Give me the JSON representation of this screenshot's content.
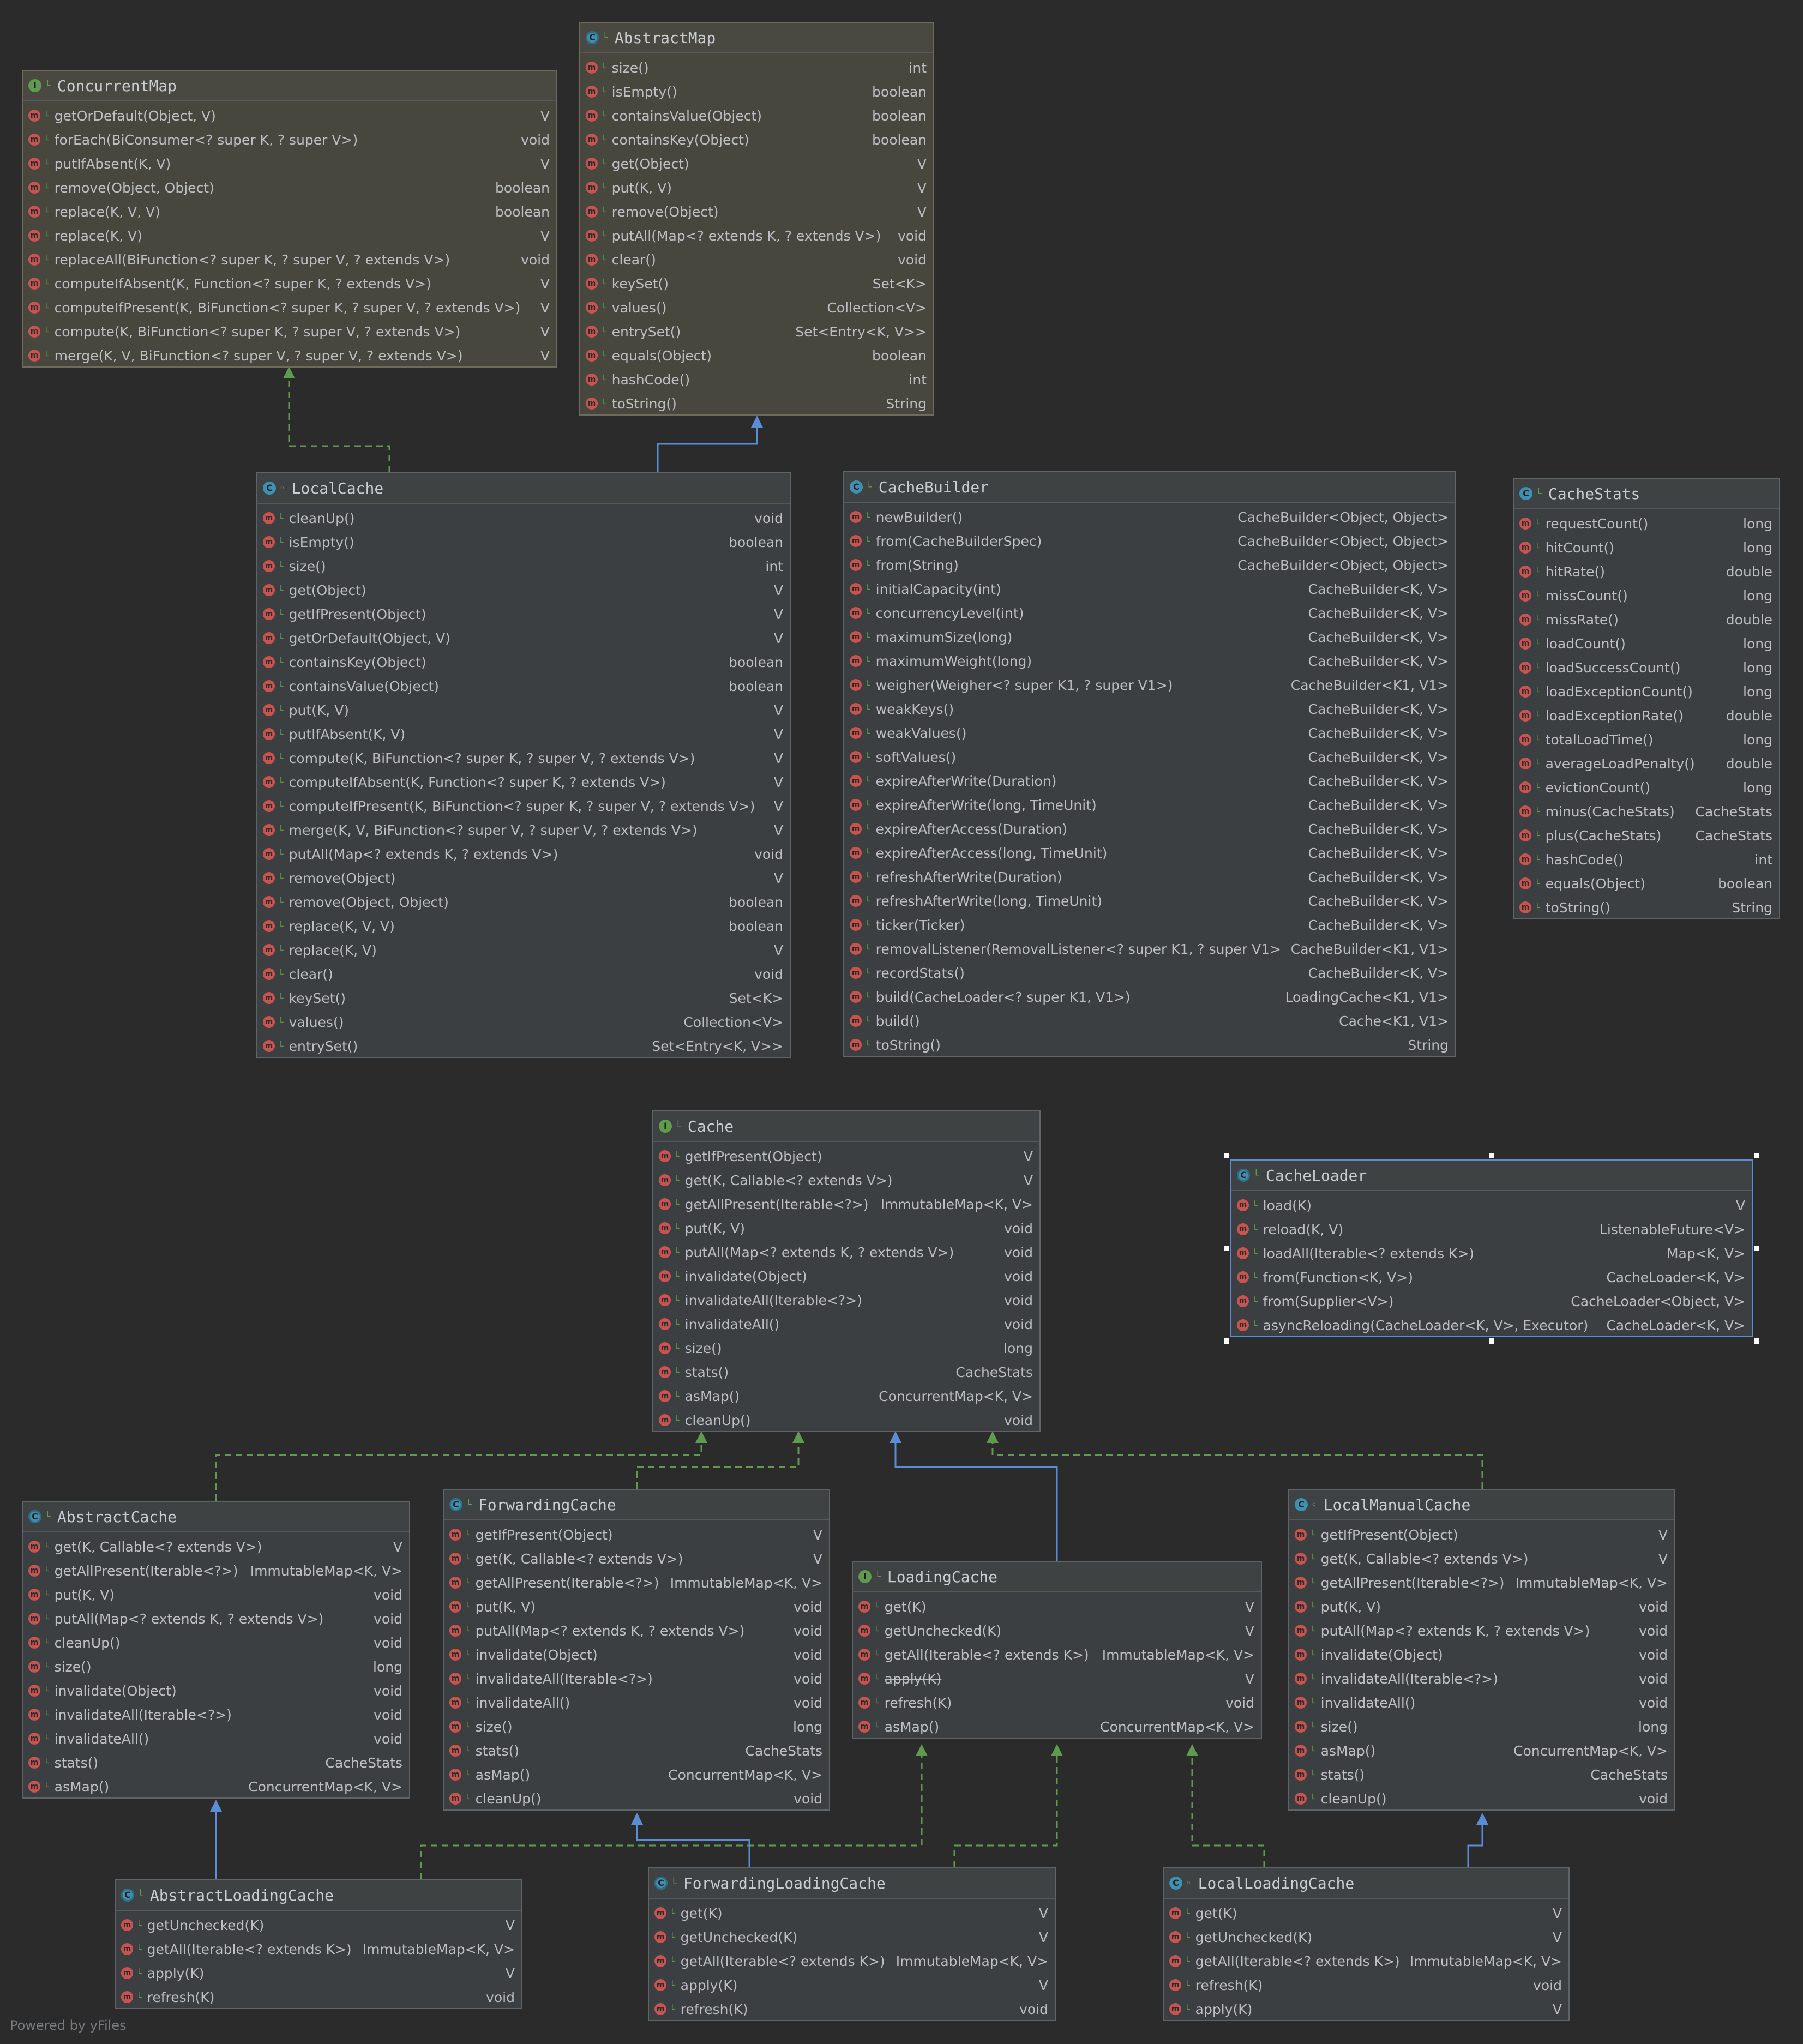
{
  "footer": "Powered by yFiles",
  "colors": {
    "implements_edge": "#5f9b4e",
    "extends_edge": "#5a8dd6",
    "method_icon": "#c75450",
    "selection": "#5a8dd6"
  },
  "classes": [
    {
      "id": "ConcurrentMap",
      "kind": "interface",
      "name": "ConcurrentMap",
      "members": [
        [
          "getOrDefault(Object, V)",
          "V"
        ],
        [
          "forEach(BiConsumer<? super K, ? super V>)",
          "void"
        ],
        [
          "putIfAbsent(K, V)",
          "V"
        ],
        [
          "remove(Object, Object)",
          "boolean"
        ],
        [
          "replace(K, V, V)",
          "boolean"
        ],
        [
          "replace(K, V)",
          "V"
        ],
        [
          "replaceAll(BiFunction<? super K, ? super V, ? extends V>)",
          "void"
        ],
        [
          "computeIfAbsent(K, Function<? super K, ? extends V>)",
          "V"
        ],
        [
          "computeIfPresent(K, BiFunction<? super K, ? super V, ? extends V>)",
          "V"
        ],
        [
          "compute(K, BiFunction<? super K, ? super V, ? extends V>)",
          "V"
        ],
        [
          "merge(K, V, BiFunction<? super V, ? super V, ? extends V>)",
          "V"
        ]
      ]
    },
    {
      "id": "AbstractMap",
      "kind": "abstract",
      "name": "AbstractMap",
      "members": [
        [
          "size()",
          "int"
        ],
        [
          "isEmpty()",
          "boolean"
        ],
        [
          "containsValue(Object)",
          "boolean"
        ],
        [
          "containsKey(Object)",
          "boolean"
        ],
        [
          "get(Object)",
          "V"
        ],
        [
          "put(K, V)",
          "V"
        ],
        [
          "remove(Object)",
          "V"
        ],
        [
          "putAll(Map<? extends K, ? extends V>)",
          "void"
        ],
        [
          "clear()",
          "void"
        ],
        [
          "keySet()",
          "Set<K>"
        ],
        [
          "values()",
          "Collection<V>"
        ],
        [
          "entrySet()",
          "Set<Entry<K, V>>"
        ],
        [
          "equals(Object)",
          "boolean"
        ],
        [
          "hashCode()",
          "int"
        ],
        [
          "toString()",
          "String"
        ]
      ]
    },
    {
      "id": "LocalCache",
      "kind": "class",
      "name": "LocalCache",
      "members": [
        [
          "cleanUp()",
          "void"
        ],
        [
          "isEmpty()",
          "boolean"
        ],
        [
          "size()",
          "int"
        ],
        [
          "get(Object)",
          "V"
        ],
        [
          "getIfPresent(Object)",
          "V"
        ],
        [
          "getOrDefault(Object, V)",
          "V"
        ],
        [
          "containsKey(Object)",
          "boolean"
        ],
        [
          "containsValue(Object)",
          "boolean"
        ],
        [
          "put(K, V)",
          "V"
        ],
        [
          "putIfAbsent(K, V)",
          "V"
        ],
        [
          "compute(K, BiFunction<? super K, ? super V, ? extends V>)",
          "V"
        ],
        [
          "computeIfAbsent(K, Function<? super K, ? extends V>)",
          "V"
        ],
        [
          "computeIfPresent(K, BiFunction<? super K, ? super V, ? extends V>)",
          "V"
        ],
        [
          "merge(K, V, BiFunction<? super V, ? super V, ? extends V>)",
          "V"
        ],
        [
          "putAll(Map<? extends K, ? extends V>)",
          "void"
        ],
        [
          "remove(Object)",
          "V"
        ],
        [
          "remove(Object, Object)",
          "boolean"
        ],
        [
          "replace(K, V, V)",
          "boolean"
        ],
        [
          "replace(K, V)",
          "V"
        ],
        [
          "clear()",
          "void"
        ],
        [
          "keySet()",
          "Set<K>"
        ],
        [
          "values()",
          "Collection<V>"
        ],
        [
          "entrySet()",
          "Set<Entry<K, V>>"
        ]
      ]
    },
    {
      "id": "CacheBuilder",
      "kind": "class",
      "name": "CacheBuilder",
      "members": [
        [
          "newBuilder()",
          "CacheBuilder<Object, Object>"
        ],
        [
          "from(CacheBuilderSpec)",
          "CacheBuilder<Object, Object>"
        ],
        [
          "from(String)",
          "CacheBuilder<Object, Object>"
        ],
        [
          "initialCapacity(int)",
          "CacheBuilder<K, V>"
        ],
        [
          "concurrencyLevel(int)",
          "CacheBuilder<K, V>"
        ],
        [
          "maximumSize(long)",
          "CacheBuilder<K, V>"
        ],
        [
          "maximumWeight(long)",
          "CacheBuilder<K, V>"
        ],
        [
          "weigher(Weigher<? super K1, ? super V1>)",
          "CacheBuilder<K1, V1>"
        ],
        [
          "weakKeys()",
          "CacheBuilder<K, V>"
        ],
        [
          "weakValues()",
          "CacheBuilder<K, V>"
        ],
        [
          "softValues()",
          "CacheBuilder<K, V>"
        ],
        [
          "expireAfterWrite(Duration)",
          "CacheBuilder<K, V>"
        ],
        [
          "expireAfterWrite(long, TimeUnit)",
          "CacheBuilder<K, V>"
        ],
        [
          "expireAfterAccess(Duration)",
          "CacheBuilder<K, V>"
        ],
        [
          "expireAfterAccess(long, TimeUnit)",
          "CacheBuilder<K, V>"
        ],
        [
          "refreshAfterWrite(Duration)",
          "CacheBuilder<K, V>"
        ],
        [
          "refreshAfterWrite(long, TimeUnit)",
          "CacheBuilder<K, V>"
        ],
        [
          "ticker(Ticker)",
          "CacheBuilder<K, V>"
        ],
        [
          "removalListener(RemovalListener<? super K1, ? super V1>)",
          "CacheBuilder<K1, V1>"
        ],
        [
          "recordStats()",
          "CacheBuilder<K, V>"
        ],
        [
          "build(CacheLoader<? super K1, V1>)",
          "LoadingCache<K1, V1>"
        ],
        [
          "build()",
          "Cache<K1, V1>"
        ],
        [
          "toString()",
          "String"
        ]
      ]
    },
    {
      "id": "CacheStats",
      "kind": "class",
      "name": "CacheStats",
      "members": [
        [
          "requestCount()",
          "long"
        ],
        [
          "hitCount()",
          "long"
        ],
        [
          "hitRate()",
          "double"
        ],
        [
          "missCount()",
          "long"
        ],
        [
          "missRate()",
          "double"
        ],
        [
          "loadCount()",
          "long"
        ],
        [
          "loadSuccessCount()",
          "long"
        ],
        [
          "loadExceptionCount()",
          "long"
        ],
        [
          "loadExceptionRate()",
          "double"
        ],
        [
          "totalLoadTime()",
          "long"
        ],
        [
          "averageLoadPenalty()",
          "double"
        ],
        [
          "evictionCount()",
          "long"
        ],
        [
          "minus(CacheStats)",
          "CacheStats"
        ],
        [
          "plus(CacheStats)",
          "CacheStats"
        ],
        [
          "hashCode()",
          "int"
        ],
        [
          "equals(Object)",
          "boolean"
        ],
        [
          "toString()",
          "String"
        ]
      ]
    },
    {
      "id": "Cache",
      "kind": "interface",
      "name": "Cache",
      "members": [
        [
          "getIfPresent(Object)",
          "V"
        ],
        [
          "get(K, Callable<? extends V>)",
          "V"
        ],
        [
          "getAllPresent(Iterable<?>)",
          "ImmutableMap<K, V>"
        ],
        [
          "put(K, V)",
          "void"
        ],
        [
          "putAll(Map<? extends K, ? extends V>)",
          "void"
        ],
        [
          "invalidate(Object)",
          "void"
        ],
        [
          "invalidateAll(Iterable<?>)",
          "void"
        ],
        [
          "invalidateAll()",
          "void"
        ],
        [
          "size()",
          "long"
        ],
        [
          "stats()",
          "CacheStats"
        ],
        [
          "asMap()",
          "ConcurrentMap<K, V>"
        ],
        [
          "cleanUp()",
          "void"
        ]
      ]
    },
    {
      "id": "CacheLoader",
      "kind": "abstract",
      "name": "CacheLoader",
      "members": [
        [
          "load(K)",
          "V"
        ],
        [
          "reload(K, V)",
          "ListenableFuture<V>"
        ],
        [
          "loadAll(Iterable<? extends K>)",
          "Map<K, V>"
        ],
        [
          "from(Function<K, V>)",
          "CacheLoader<K, V>"
        ],
        [
          "from(Supplier<V>)",
          "CacheLoader<Object, V>"
        ],
        [
          "asyncReloading(CacheLoader<K, V>, Executor)",
          "CacheLoader<K, V>"
        ]
      ]
    },
    {
      "id": "AbstractCache",
      "kind": "abstract",
      "name": "AbstractCache",
      "members": [
        [
          "get(K, Callable<? extends V>)",
          "V"
        ],
        [
          "getAllPresent(Iterable<?>)",
          "ImmutableMap<K, V>"
        ],
        [
          "put(K, V)",
          "void"
        ],
        [
          "putAll(Map<? extends K, ? extends V>)",
          "void"
        ],
        [
          "cleanUp()",
          "void"
        ],
        [
          "size()",
          "long"
        ],
        [
          "invalidate(Object)",
          "void"
        ],
        [
          "invalidateAll(Iterable<?>)",
          "void"
        ],
        [
          "invalidateAll()",
          "void"
        ],
        [
          "stats()",
          "CacheStats"
        ],
        [
          "asMap()",
          "ConcurrentMap<K, V>"
        ]
      ]
    },
    {
      "id": "ForwardingCache",
      "kind": "abstract",
      "name": "ForwardingCache",
      "members": [
        [
          "getIfPresent(Object)",
          "V"
        ],
        [
          "get(K, Callable<? extends V>)",
          "V"
        ],
        [
          "getAllPresent(Iterable<?>)",
          "ImmutableMap<K, V>"
        ],
        [
          "put(K, V)",
          "void"
        ],
        [
          "putAll(Map<? extends K, ? extends V>)",
          "void"
        ],
        [
          "invalidate(Object)",
          "void"
        ],
        [
          "invalidateAll(Iterable<?>)",
          "void"
        ],
        [
          "invalidateAll()",
          "void"
        ],
        [
          "size()",
          "long"
        ],
        [
          "stats()",
          "CacheStats"
        ],
        [
          "asMap()",
          "ConcurrentMap<K, V>"
        ],
        [
          "cleanUp()",
          "void"
        ]
      ]
    },
    {
      "id": "LoadingCache",
      "kind": "interface",
      "name": "LoadingCache",
      "members": [
        [
          "get(K)",
          "V"
        ],
        [
          "getUnchecked(K)",
          "V"
        ],
        [
          "getAll(Iterable<? extends K>)",
          "ImmutableMap<K, V>"
        ],
        [
          "apply(K)",
          "V"
        ],
        [
          "refresh(K)",
          "void"
        ],
        [
          "asMap()",
          "ConcurrentMap<K, V>"
        ]
      ]
    },
    {
      "id": "LocalManualCache",
      "kind": "class",
      "name": "LocalManualCache",
      "members": [
        [
          "getIfPresent(Object)",
          "V"
        ],
        [
          "get(K, Callable<? extends V>)",
          "V"
        ],
        [
          "getAllPresent(Iterable<?>)",
          "ImmutableMap<K, V>"
        ],
        [
          "put(K, V)",
          "void"
        ],
        [
          "putAll(Map<? extends K, ? extends V>)",
          "void"
        ],
        [
          "invalidate(Object)",
          "void"
        ],
        [
          "invalidateAll(Iterable<?>)",
          "void"
        ],
        [
          "invalidateAll()",
          "void"
        ],
        [
          "size()",
          "long"
        ],
        [
          "asMap()",
          "ConcurrentMap<K, V>"
        ],
        [
          "stats()",
          "CacheStats"
        ],
        [
          "cleanUp()",
          "void"
        ]
      ]
    },
    {
      "id": "AbstractLoadingCache",
      "kind": "abstract",
      "name": "AbstractLoadingCache",
      "members": [
        [
          "getUnchecked(K)",
          "V"
        ],
        [
          "getAll(Iterable<? extends K>)",
          "ImmutableMap<K, V>"
        ],
        [
          "apply(K)",
          "V"
        ],
        [
          "refresh(K)",
          "void"
        ]
      ]
    },
    {
      "id": "ForwardingLoadingCache",
      "kind": "abstract",
      "name": "ForwardingLoadingCache",
      "members": [
        [
          "get(K)",
          "V"
        ],
        [
          "getUnchecked(K)",
          "V"
        ],
        [
          "getAll(Iterable<? extends K>)",
          "ImmutableMap<K, V>"
        ],
        [
          "apply(K)",
          "V"
        ],
        [
          "refresh(K)",
          "void"
        ]
      ]
    },
    {
      "id": "LocalLoadingCache",
      "kind": "class",
      "name": "LocalLoadingCache",
      "members": [
        [
          "get(K)",
          "V"
        ],
        [
          "getUnchecked(K)",
          "V"
        ],
        [
          "getAll(Iterable<? extends K>)",
          "ImmutableMap<K, V>"
        ],
        [
          "refresh(K)",
          "void"
        ],
        [
          "apply(K)",
          "V"
        ]
      ]
    }
  ],
  "relations": [
    {
      "from": "LocalCache",
      "to": "ConcurrentMap",
      "type": "implements"
    },
    {
      "from": "LocalCache",
      "to": "AbstractMap",
      "type": "extends"
    },
    {
      "from": "AbstractCache",
      "to": "Cache",
      "type": "implements"
    },
    {
      "from": "ForwardingCache",
      "to": "Cache",
      "type": "implements"
    },
    {
      "from": "LoadingCache",
      "to": "Cache",
      "type": "extends"
    },
    {
      "from": "LocalManualCache",
      "to": "Cache",
      "type": "implements"
    },
    {
      "from": "AbstractLoadingCache",
      "to": "AbstractCache",
      "type": "extends"
    },
    {
      "from": "AbstractLoadingCache",
      "to": "LoadingCache",
      "type": "implements"
    },
    {
      "from": "ForwardingLoadingCache",
      "to": "ForwardingCache",
      "type": "extends"
    },
    {
      "from": "ForwardingLoadingCache",
      "to": "LoadingCache",
      "type": "implements"
    },
    {
      "from": "LocalLoadingCache",
      "to": "LoadingCache",
      "type": "implements"
    },
    {
      "from": "LocalLoadingCache",
      "to": "LocalManualCache",
      "type": "extends"
    }
  ]
}
